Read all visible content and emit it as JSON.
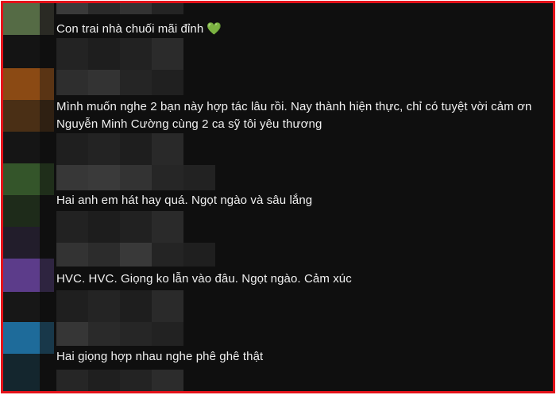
{
  "comments": [
    {
      "text": "Con trai nhà chuối mãi đỉnh",
      "emoji": "💚"
    },
    {
      "text": "Mình muốn nghe 2 bạn này hợp tác lâu rồi. Nay thành hiện thực, chỉ có tuyệt vời cảm ơn Nguyễn Minh Cường cùng 2 ca sỹ tôi yêu thương"
    },
    {
      "text": "Hai anh em hát hay quá. Ngọt ngào và sâu lắng"
    },
    {
      "text": "HVC. HVC. Giọng ko lẫn vào đâu. Ngọt ngào. Cảm xúc"
    },
    {
      "text": "Hai giọng hợp nhau nghe phê ghê thật"
    }
  ],
  "colors": {
    "frame_border": "#e3121a",
    "background": "#0f0f0f",
    "text": "#f1f1f1",
    "heart": "#7ac943"
  }
}
